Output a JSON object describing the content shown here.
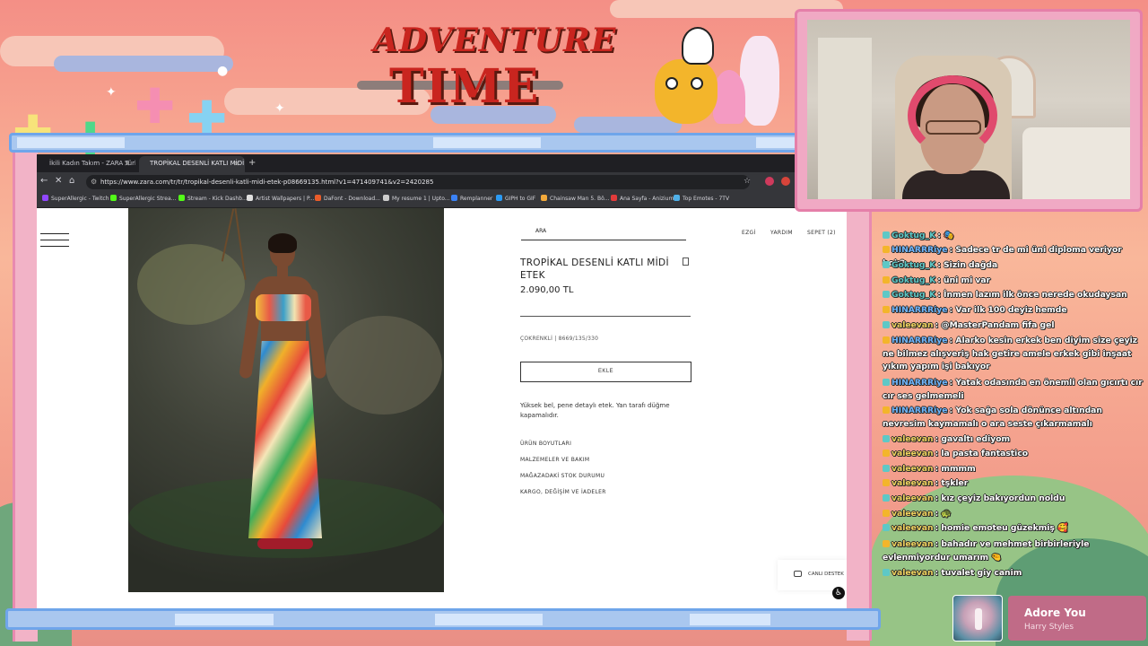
{
  "overlay": {
    "title_line1": "ADVENTURE",
    "title_line2": "TIME"
  },
  "browser": {
    "tabs": [
      {
        "label": "İkili Kadın Takım - ZARA Türk"
      },
      {
        "label": "TROPİKAL DESENLİ KATLI MİDİ"
      }
    ],
    "url": "https://www.zara.com/tr/tr/tropikal-desenli-katli-midi-etek-p08669135.html?v1=471409741&v2=2420285",
    "bookmarks": [
      {
        "label": "SuperAllergic - Twitch",
        "color": "#9147ff"
      },
      {
        "label": "SuperAllergic Strea...",
        "color": "#53fc18"
      },
      {
        "label": "Stream - Kick Dashb...",
        "color": "#53fc18"
      },
      {
        "label": "Artist Wallpapers | P...",
        "color": "#e0e0e0"
      },
      {
        "label": "DaFont - Download...",
        "color": "#e95c2a"
      },
      {
        "label": "My resume 1 | Upto...",
        "color": "#cccccc"
      },
      {
        "label": "Remplanner",
        "color": "#3b82f6"
      },
      {
        "label": "GIPH to GIF",
        "color": "#2b9af3"
      },
      {
        "label": "Chainsaw Man 5. Bö...",
        "color": "#f2a93b"
      },
      {
        "label": "Ana Sayfa - Anizium",
        "color": "#e23b3b"
      },
      {
        "label": "Top Emotes - 7TV",
        "color": "#4fb0e8"
      }
    ]
  },
  "product": {
    "search_label": "ARA",
    "nav": {
      "account": "EZGİ",
      "help": "YARDIM",
      "cart": "SEPET (2)"
    },
    "title": "TROPİKAL DESENLİ KATLI MİDİ ETEK",
    "price": "2.090,00 TL",
    "color_ref": "ÇOKRENKLİ | 8669/135/330",
    "add_button": "EKLE",
    "description": "Yüksek bel, pene detaylı etek. Yan tarafı düğme kapamalıdır.",
    "links": [
      "ÜRÜN BOYUTLARI",
      "MALZEMELER VE BAKIM",
      "MAĞAZADAKİ STOK DURUMU",
      "KARGO, DEĞİŞİM VE İADELER"
    ],
    "live_support": "CANLI DESTEK"
  },
  "chat": [
    {
      "user": "Goktug_K",
      "text": ": 🎭",
      "color": "#5ec8c6"
    },
    {
      "user": "HINARRRiye",
      "text": ": Sadece tr de mi üni diploma veriyor bok2",
      "color": "#6fb7ff"
    },
    {
      "user": "Goktug_K",
      "text": ": Sizin dağda",
      "color": "#5ec8c6"
    },
    {
      "user": "Goktug_K",
      "text": ": üni mi var",
      "color": "#5ec8c6"
    },
    {
      "user": "Goktug_K",
      "text": ": İnmen lazım ilk önce nerede okudaysan",
      "color": "#5ec8c6"
    },
    {
      "user": "HINARRRiye",
      "text": ": Var ilk 100 deyiz hemde",
      "color": "#6fb7ff"
    },
    {
      "user": "valeevan",
      "text": ": @MasterPandam fifa gel",
      "color": "#f0d35e"
    },
    {
      "user": "HINARRRiye",
      "text": ": Alarko kesin erkek ben diyim size çeyiz ne bilmez alışveriş hak getire amele erkek gibi inşaat yıkım yapım işi bakıyor",
      "color": "#6fb7ff"
    },
    {
      "user": "HINARRRiye",
      "text": ": Yatak odasında en önemli olan gıcırtı cır cır ses gelmemeli",
      "color": "#6fb7ff"
    },
    {
      "user": "HINARRRiye",
      "text": ": Yok sağa sola dönünce altından nevresim kaymamalı o ara seste çıkarmamalı",
      "color": "#6fb7ff"
    },
    {
      "user": "valeevan",
      "text": ": gavaltı ediyom",
      "color": "#f0d35e"
    },
    {
      "user": "valeevan",
      "text": ": la pasta fantastico",
      "color": "#f0d35e"
    },
    {
      "user": "valeevan",
      "text": ": mmmm",
      "color": "#f0d35e"
    },
    {
      "user": "valeevan",
      "text": ": tşkler",
      "color": "#f0d35e"
    },
    {
      "user": "valeevan",
      "text": ": kız çeyiz bakıyordun noldu",
      "color": "#f0d35e"
    },
    {
      "user": "valeevan",
      "text": ": 🐢",
      "color": "#f0d35e"
    },
    {
      "user": "valeevan",
      "text": ": homie emoteu güzekmiş 🥰",
      "color": "#f0d35e"
    },
    {
      "user": "valeevan",
      "text": ": bahadır ve mehmet birbirleriyle evlenmiyordur umarım 🤏",
      "color": "#f0d35e"
    },
    {
      "user": "valeevan",
      "text": ": tuvalet giy canim",
      "color": "#f0d35e"
    }
  ],
  "now_playing": {
    "title": "Adore You",
    "artist": "Harry Styles"
  },
  "icons": [
    "back-icon",
    "forward-icon",
    "reload-icon",
    "home-icon",
    "star-icon",
    "menu-icon",
    "bookmark-icon",
    "chat-bubble-icon",
    "accessibility-icon"
  ]
}
